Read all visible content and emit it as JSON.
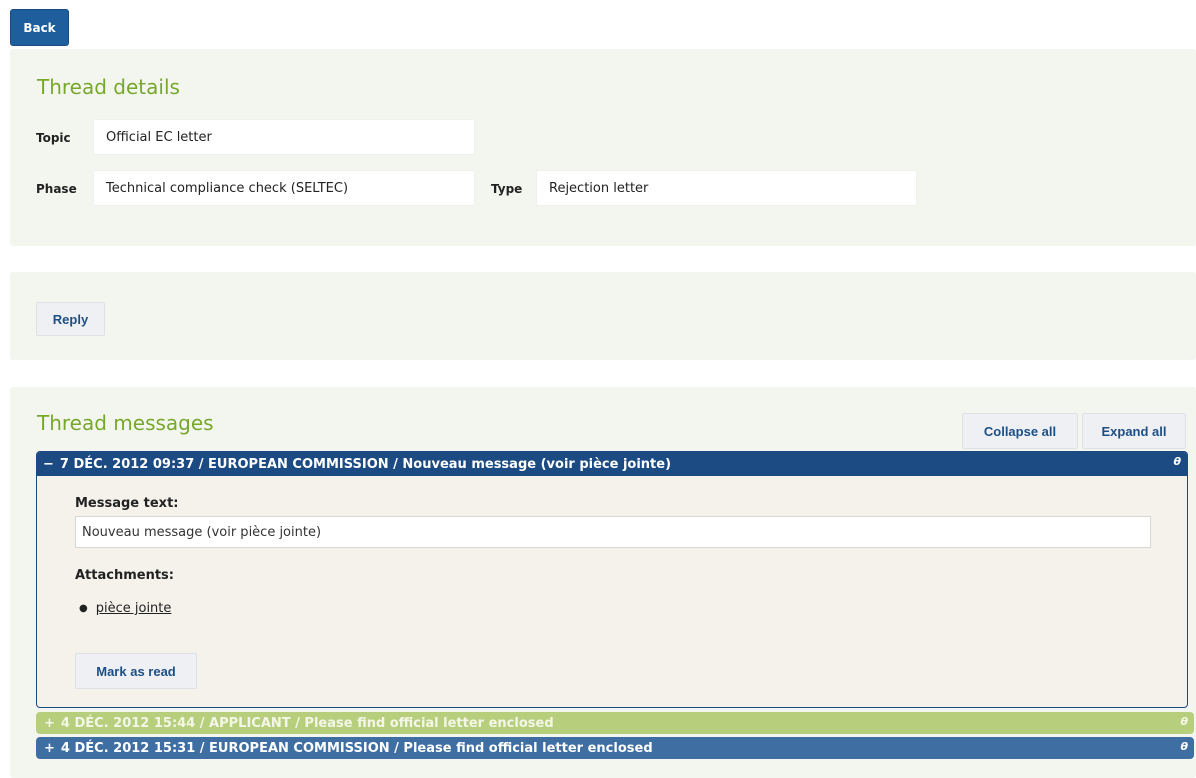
{
  "toolbar": {
    "back_label": "Back"
  },
  "details": {
    "title": "Thread details",
    "topic_label": "Topic",
    "topic_value": "Official EC letter",
    "phase_label": "Phase",
    "phase_value": "Technical compliance check (SELTEC)",
    "type_label": "Type",
    "type_value": "Rejection letter"
  },
  "reply": {
    "reply_label": "Reply"
  },
  "messages": {
    "title": "Thread messages",
    "collapse_all_label": "Collapse all",
    "expand_all_label": "Expand all",
    "items": [
      {
        "toggle": "−",
        "header": "7 DÉC. 2012 09:37 / EUROPEAN COMMISSION / Nouveau message (voir pièce jointe)",
        "corner": "θ",
        "message_text_label": "Message text:",
        "message_text": "Nouveau message (voir pièce jointe)",
        "attachments_label": "Attachments:",
        "attachments": [
          "pièce jointe"
        ],
        "mark_read_label": "Mark as read",
        "state": "expanded"
      },
      {
        "toggle": "+",
        "header": "4 DÉC. 2012 15:44 / APPLICANT / Please find official letter enclosed",
        "corner": "θ",
        "state": "collapsed"
      },
      {
        "toggle": "+",
        "header": "4 DÉC. 2012 15:31 / EUROPEAN COMMISSION / Please find official letter enclosed",
        "corner": "θ",
        "state": "collapsed"
      }
    ]
  },
  "colors": {
    "accent_green": "#77a82b",
    "primary_blue": "#1c4a83",
    "applicant_green": "#b7cf7d",
    "commission_blue": "#3f6ea3"
  }
}
